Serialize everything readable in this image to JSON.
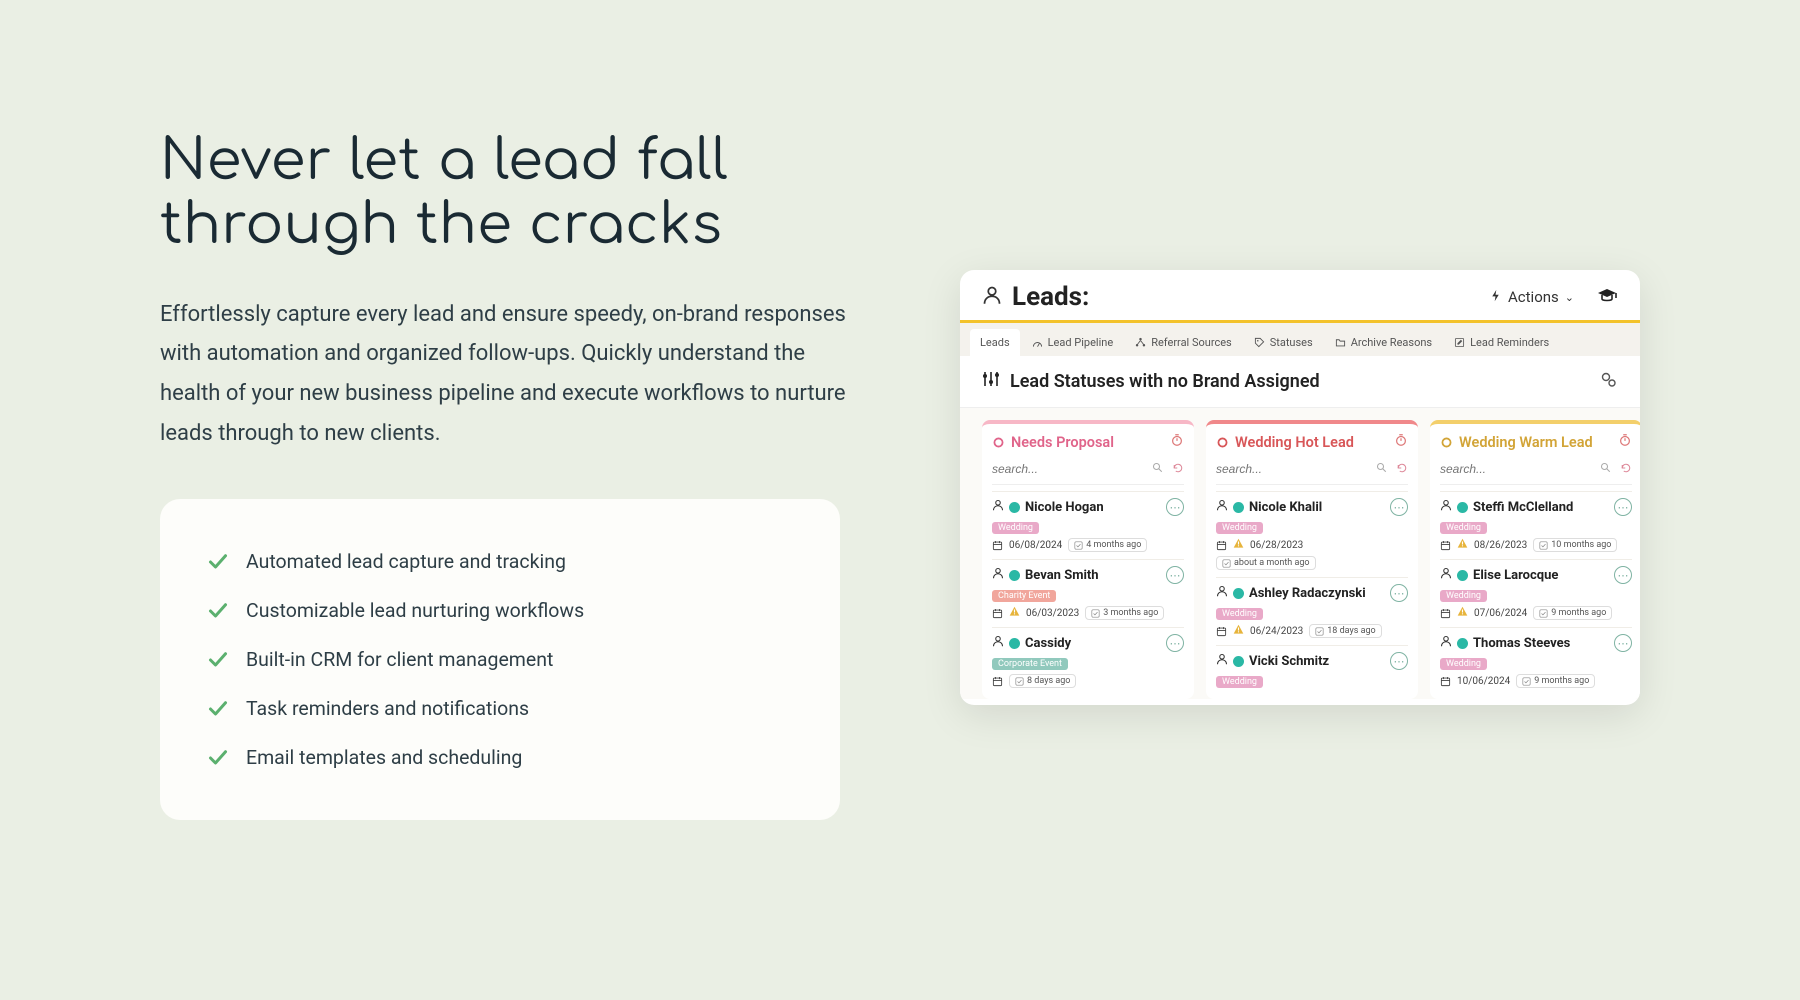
{
  "hero": {
    "headline": "Never let a lead fall through the cracks",
    "subtext": "Effortlessly capture every lead and ensure speedy, on-brand responses with automation and organized follow-ups. Quickly understand the health of your new business pipeline and execute workflows to nurture leads through to new clients."
  },
  "features": [
    "Automated lead capture and tracking",
    "Customizable lead nurturing workflows",
    "Built-in CRM for client management",
    "Task reminders and notifications",
    "Email templates and scheduling"
  ],
  "app": {
    "title": "Leads:",
    "actions_label": "Actions",
    "tabs": [
      {
        "label": "Leads",
        "active": true
      },
      {
        "label": "Lead Pipeline"
      },
      {
        "label": "Referral Sources"
      },
      {
        "label": "Statuses"
      },
      {
        "label": "Archive Reasons"
      },
      {
        "label": "Lead Reminders"
      }
    ],
    "section_title": "Lead Statuses with no Brand Assigned",
    "search_placeholder": "search...",
    "columns": [
      {
        "title": "Needs Proposal",
        "color": "pink",
        "cards": [
          {
            "name": "Nicole Hogan",
            "tag": "Wedding",
            "tag_color": "pink",
            "date": "06/08/2024",
            "warn": false,
            "ago": "4 months ago"
          },
          {
            "name": "Bevan Smith",
            "tag": "Charity Event",
            "tag_color": "coral",
            "date": "06/03/2023",
            "warn": true,
            "ago": "3 months ago"
          },
          {
            "name": "Cassidy",
            "tag": "Corporate Event",
            "tag_color": "teal",
            "date": "",
            "warn": false,
            "ago": "8 days ago"
          }
        ]
      },
      {
        "title": "Wedding Hot Lead",
        "color": "red",
        "cards": [
          {
            "name": "Nicole Khalil",
            "tag": "Wedding",
            "tag_color": "pink",
            "date": "06/28/2023",
            "warn": true,
            "ago": "about a month ago",
            "ago_below": true
          },
          {
            "name": "Ashley Radaczynski",
            "tag": "Wedding",
            "tag_color": "pink",
            "date": "06/24/2023",
            "warn": true,
            "ago": "18 days ago"
          },
          {
            "name": "Vicki Schmitz",
            "tag": "Wedding",
            "tag_color": "pink",
            "date": "",
            "warn": true,
            "ago": ""
          }
        ]
      },
      {
        "title": "Wedding Warm Lead",
        "color": "yel",
        "cards": [
          {
            "name": "Steffi McClelland",
            "tag": "Wedding",
            "tag_color": "pink",
            "date": "08/26/2023",
            "warn": true,
            "ago": "10 months ago"
          },
          {
            "name": "Elise Larocque",
            "tag": "Wedding",
            "tag_color": "pink",
            "date": "07/06/2024",
            "warn": true,
            "ago": "9 months ago"
          },
          {
            "name": "Thomas Steeves",
            "tag": "Wedding",
            "tag_color": "pink",
            "date": "10/06/2024",
            "warn": false,
            "ago": "9 months ago"
          }
        ]
      }
    ]
  }
}
